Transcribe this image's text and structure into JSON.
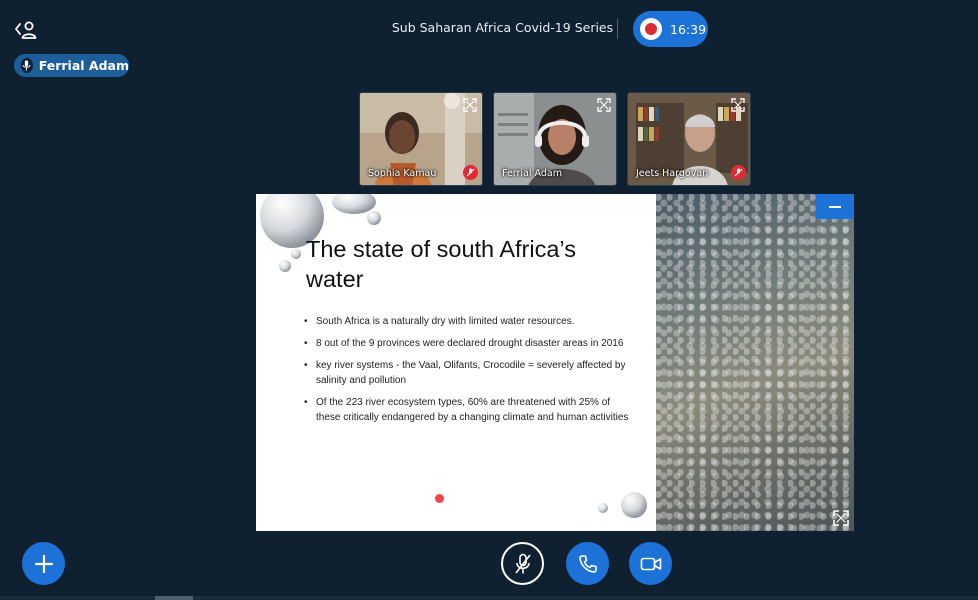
{
  "header": {
    "meeting_title": "Sub Saharan Africa Covid-19 Series",
    "recording_time": "16:39",
    "recording_color": "#e02a34"
  },
  "talker": {
    "name": "Ferrial Adam"
  },
  "participants": [
    {
      "name": "Sophia Kamau",
      "muted": true
    },
    {
      "name": "Ferrial Adam",
      "muted": false
    },
    {
      "name": "Jeets Hargovan",
      "muted": true
    }
  ],
  "slide": {
    "heading": "The state of south Africa’s water",
    "bullets": [
      "South Africa is a naturally dry with limited water resources.",
      "8 out of the 9 provinces were declared drought disaster areas in 2016",
      "key river systems - the Vaal, Olifants, Crocodile = severely affected by salinity and pollution",
      "Of the 223 river ecosystem types, 60% are threatened with 25% of these critically endangered by a changing climate and human activities"
    ]
  },
  "icons": {
    "users_toggle": "users-toggle-icon",
    "talker_mic": "microphone-icon",
    "fullscreen": "fullscreen-icon",
    "muted": "muted-icon",
    "actions": "plus-icon",
    "mic": "microphone-off-icon",
    "phone": "phone-icon",
    "video": "camera-icon"
  },
  "colors": {
    "background": "#0f2131",
    "accent": "#1d72d8",
    "danger": "#e02a34"
  }
}
